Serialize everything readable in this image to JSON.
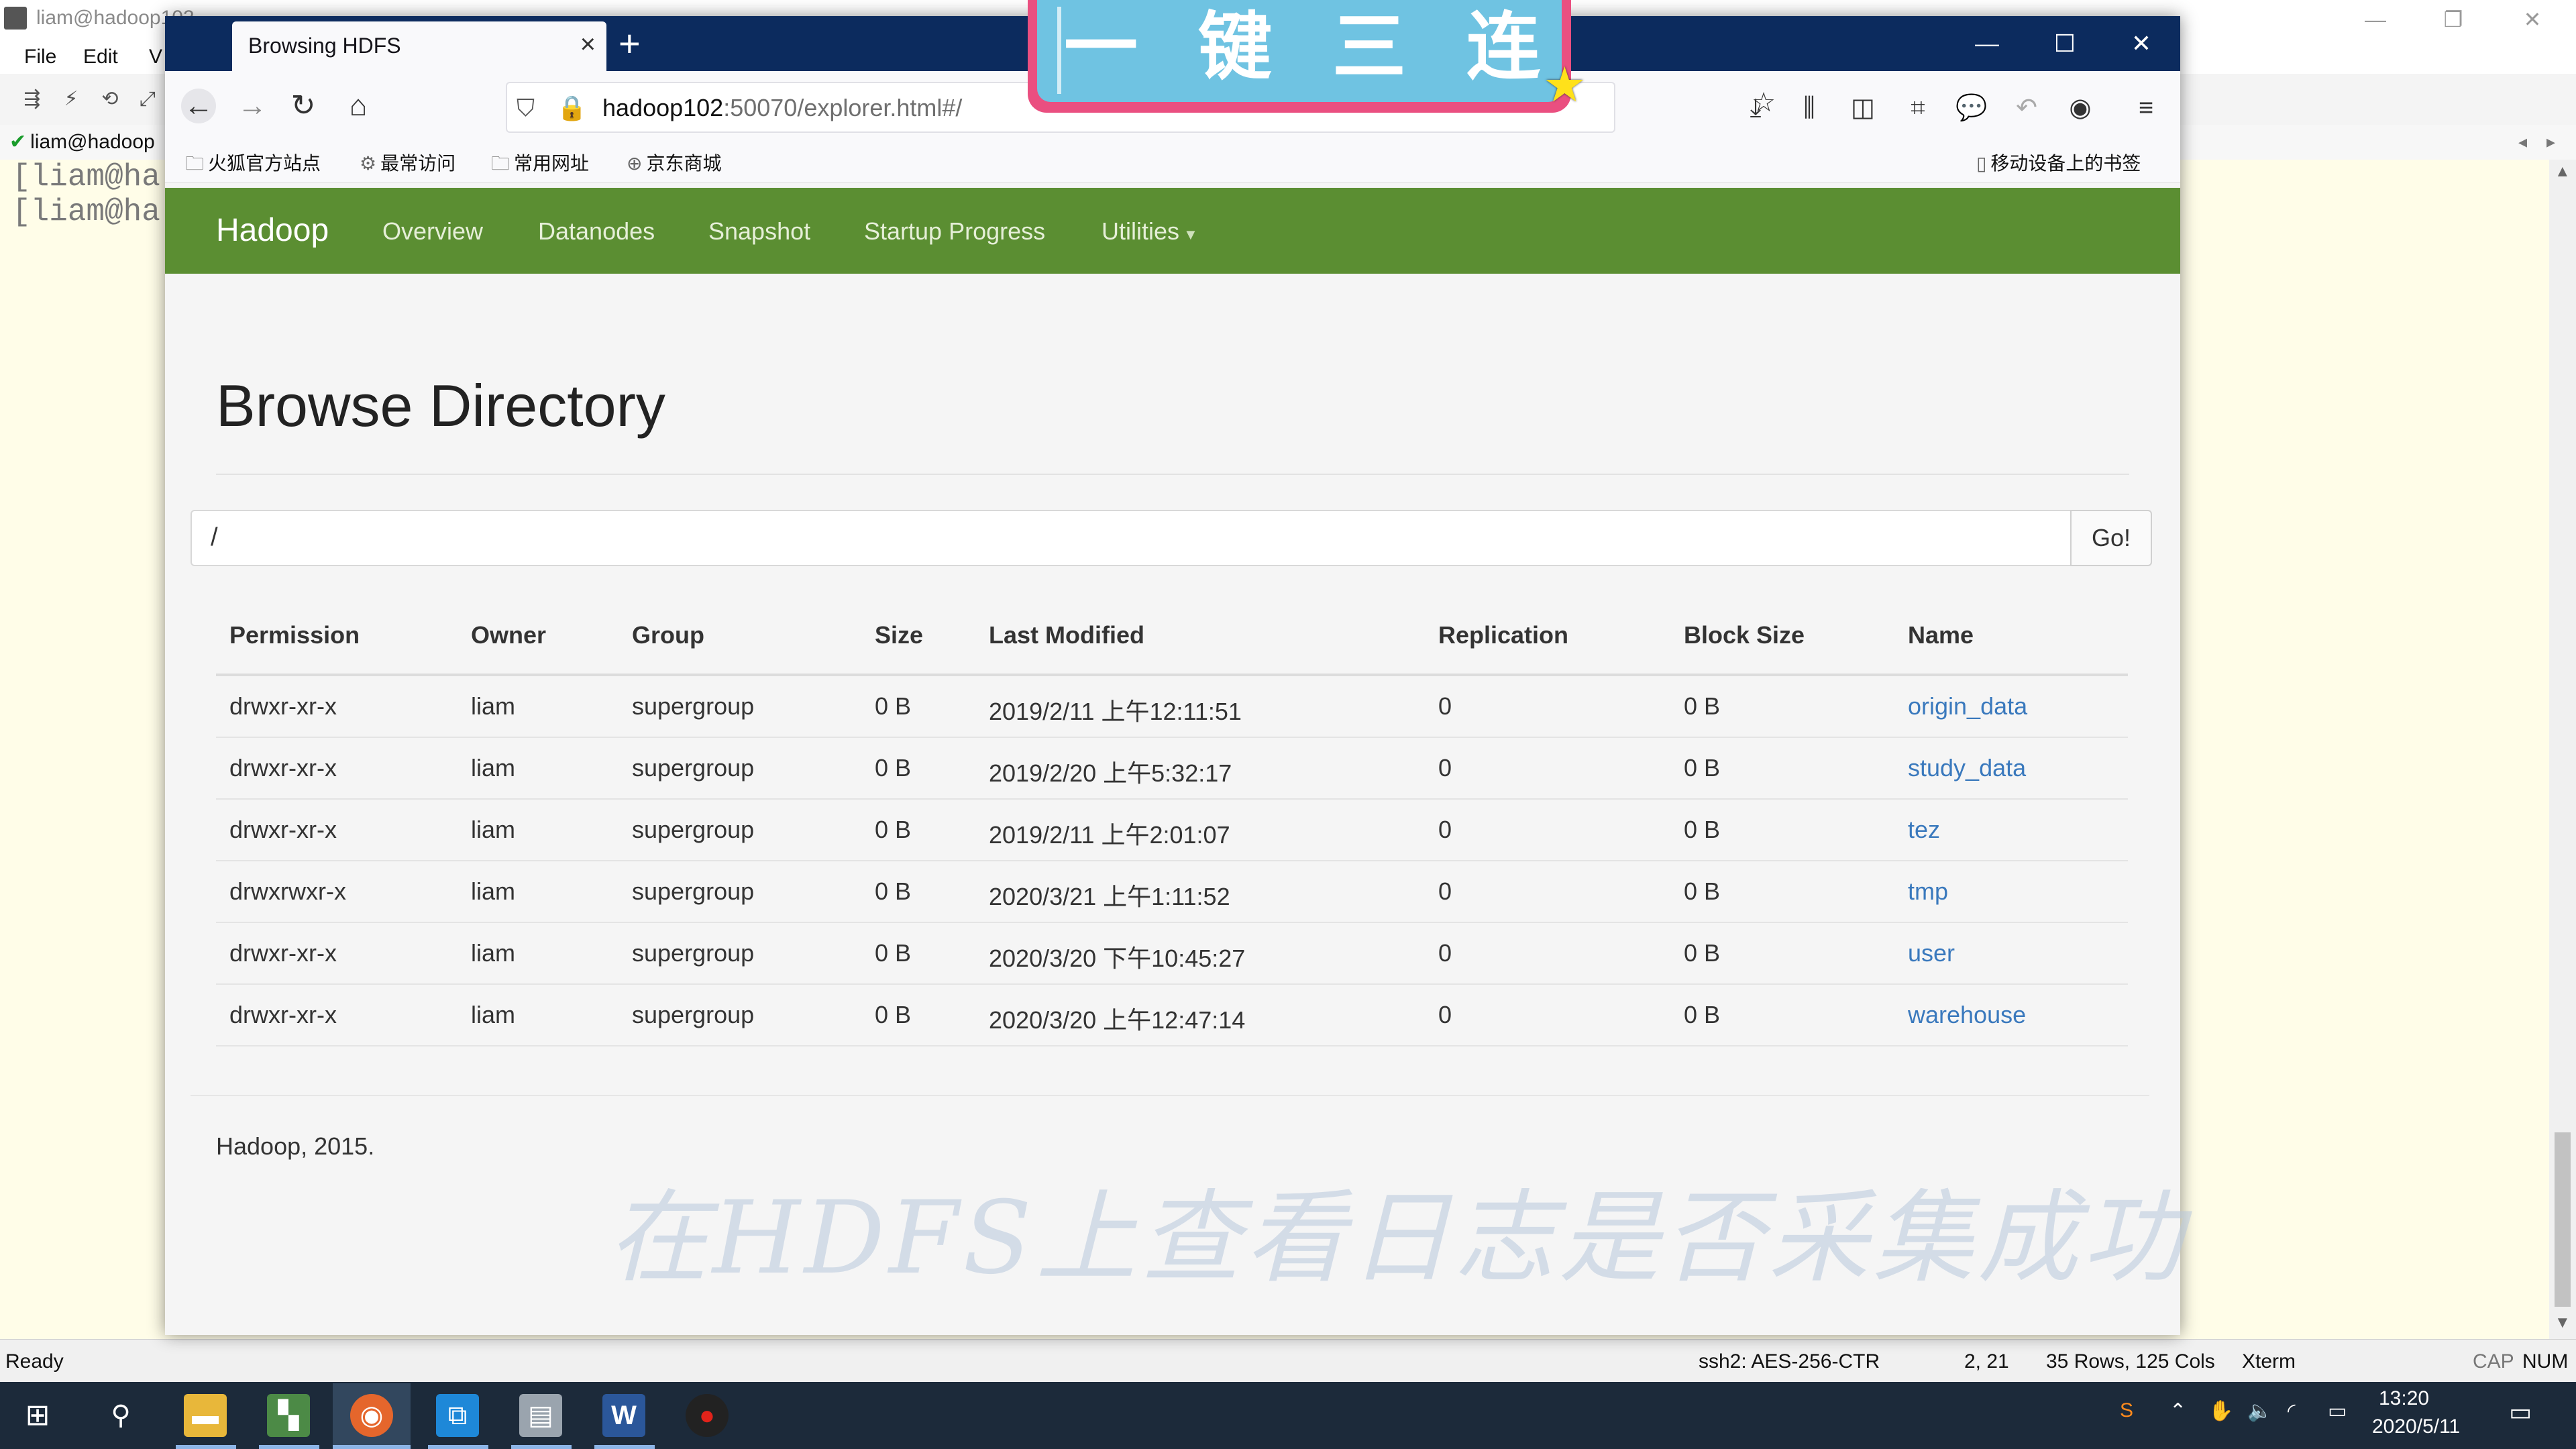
{
  "xshell": {
    "title": "liam@hadoop102",
    "menu": [
      "File",
      "Edit",
      "V"
    ],
    "session_tab": "liam@hadoop",
    "terminal_lines": [
      "[liam@ha",
      "[liam@ha"
    ],
    "status": {
      "ready": "Ready",
      "cipher": "ssh2: AES-256-CTR",
      "cursor": "2, 21",
      "size": "35 Rows, 125 Cols",
      "term": "Xterm",
      "cap": "CAP",
      "num": "NUM"
    }
  },
  "firefox": {
    "tab_title": "Browsing HDFS",
    "url_host": "hadoop102",
    "url_rest": ":50070/explorer.html#/",
    "bookmarks": [
      "火狐官方站点",
      "最常访问",
      "常用网址",
      "京东商城"
    ],
    "mobile_bookmarks": "移动设备上的书签"
  },
  "hadoop": {
    "brand": "Hadoop",
    "nav": [
      "Overview",
      "Datanodes",
      "Snapshot",
      "Startup Progress",
      "Utilities"
    ],
    "page_title": "Browse Directory",
    "path_value": "/",
    "go_label": "Go!",
    "columns": [
      "Permission",
      "Owner",
      "Group",
      "Size",
      "Last Modified",
      "Replication",
      "Block Size",
      "Name"
    ],
    "rows": [
      [
        "drwxr-xr-x",
        "liam",
        "supergroup",
        "0 B",
        "2019/2/11 上午12:11:51",
        "0",
        "0 B",
        "origin_data"
      ],
      [
        "drwxr-xr-x",
        "liam",
        "supergroup",
        "0 B",
        "2019/2/20 上午5:32:17",
        "0",
        "0 B",
        "study_data"
      ],
      [
        "drwxr-xr-x",
        "liam",
        "supergroup",
        "0 B",
        "2019/2/11 上午2:01:07",
        "0",
        "0 B",
        "tez"
      ],
      [
        "drwxrwxr-x",
        "liam",
        "supergroup",
        "0 B",
        "2020/3/21 上午1:11:52",
        "0",
        "0 B",
        "tmp"
      ],
      [
        "drwxr-xr-x",
        "liam",
        "supergroup",
        "0 B",
        "2020/3/20 下午10:45:27",
        "0",
        "0 B",
        "user"
      ],
      [
        "drwxr-xr-x",
        "liam",
        "supergroup",
        "0 B",
        "2020/3/20 上午12:47:14",
        "0",
        "0 B",
        "warehouse"
      ]
    ],
    "footer": "Hadoop, 2015."
  },
  "overlay": {
    "banner_text": "一键三连",
    "watermark": "在HDFS上查看日志是否采集成功"
  },
  "taskbar": {
    "time": "13:20",
    "date": "2020/5/11"
  }
}
